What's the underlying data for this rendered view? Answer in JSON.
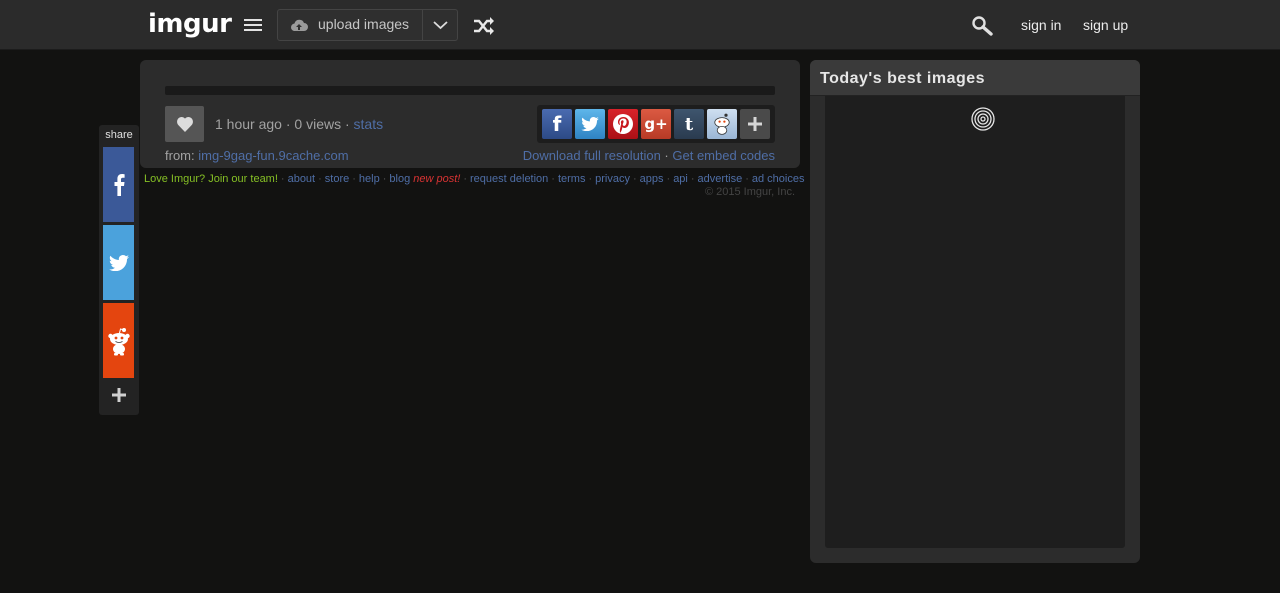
{
  "header": {
    "logo": "imgur",
    "upload_label": "upload images",
    "sign_in": "sign in",
    "sign_up": "sign up",
    "icons": [
      "menu-icon",
      "cloud-upload-icon",
      "chevron-down-icon",
      "shuffle-icon",
      "search-icon"
    ]
  },
  "share_sidebar": {
    "title": "share",
    "buttons": [
      "facebook",
      "twitter",
      "reddit",
      "more"
    ],
    "colors": {
      "facebook": "#3b5998",
      "twitter": "#4ba2dc",
      "reddit": "#e4450f"
    }
  },
  "post": {
    "time_ago": "1 hour ago",
    "views": "0 views",
    "stats": "stats",
    "from_label": "from:",
    "source": "img-9gag-fun.9cache.com",
    "download": "Download full resolution",
    "embed": "Get embed codes",
    "share_icons": [
      "facebook",
      "twitter",
      "pinterest",
      "google-plus",
      "tumblr",
      "reddit",
      "more"
    ]
  },
  "footer": {
    "join": "Love Imgur? Join our team!",
    "links": {
      "about": "about",
      "store": "store",
      "help": "help",
      "blog": "blog",
      "request_deletion": "request deletion",
      "terms": "terms",
      "privacy": "privacy",
      "apps": "apps",
      "api": "api",
      "advertise": "advertise",
      "ad_choices": "ad choices"
    },
    "new_post": "new post!",
    "copyright": "© 2015 Imgur, Inc."
  },
  "sidebar": {
    "title": "Today's best images"
  },
  "colors": {
    "background": "#121211",
    "panel": "#2c2c2c",
    "link": "#4f6ea6",
    "join": "#85bf25",
    "new_post": "#d93333"
  }
}
